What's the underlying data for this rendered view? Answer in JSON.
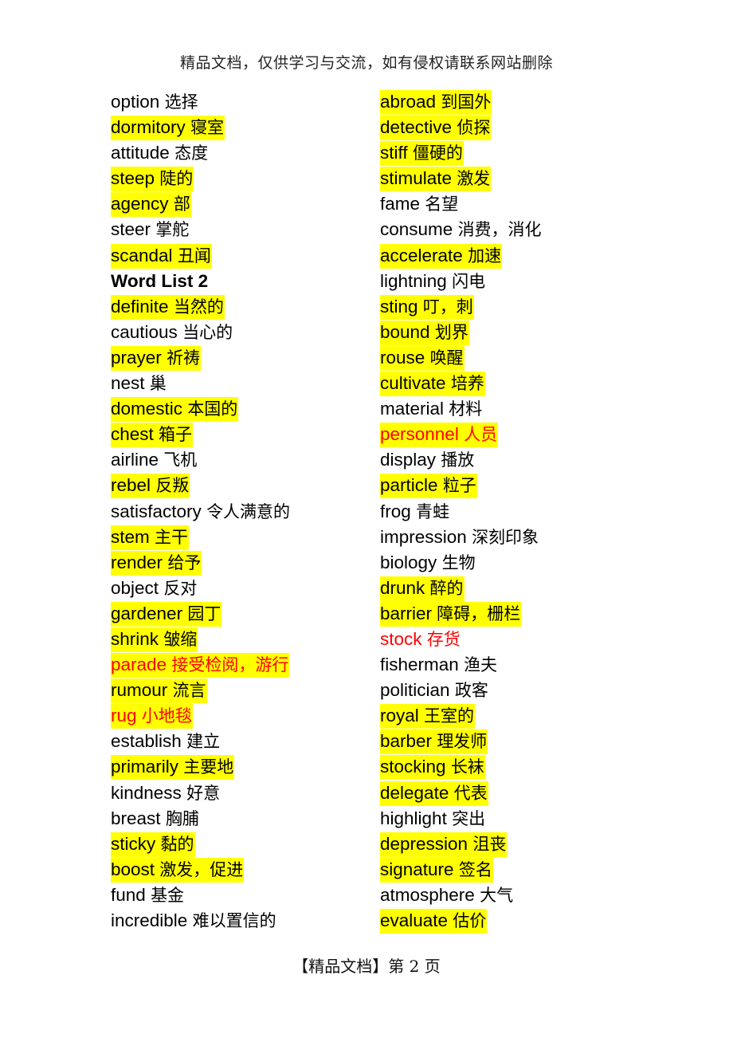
{
  "document": {
    "header": "精品文档，仅供学习与交流，如有侵权请联系网站删除",
    "footer": "【精品文档】第 2 页",
    "colors": {
      "highlight": "#ffff00",
      "emphasis_text": "#ff0000",
      "normal_text": "#000000"
    },
    "left_column": [
      {
        "en": "option",
        "cn": "选择",
        "highlight": false,
        "red": false
      },
      {
        "en": "dormitory",
        "cn": "寝室",
        "highlight": true,
        "red": false
      },
      {
        "en": "attitude",
        "cn": "态度",
        "highlight": false,
        "red": false
      },
      {
        "en": "steep",
        "cn": "陡的",
        "highlight": true,
        "red": false
      },
      {
        "en": "agency",
        "cn": "部",
        "highlight": true,
        "red": false
      },
      {
        "en": "steer",
        "cn": "掌舵",
        "highlight": false,
        "red": false
      },
      {
        "en": "scandal",
        "cn": "丑闻",
        "highlight": true,
        "red": false
      },
      {
        "en": "Word List 2",
        "cn": "",
        "highlight": false,
        "red": false,
        "heading": true
      },
      {
        "en": "definite",
        "cn": "当然的",
        "highlight": true,
        "red": false
      },
      {
        "en": "cautious",
        "cn": "当心的",
        "highlight": false,
        "red": false
      },
      {
        "en": "prayer",
        "cn": "祈祷",
        "highlight": true,
        "red": false
      },
      {
        "en": "nest",
        "cn": "巢",
        "highlight": false,
        "red": false
      },
      {
        "en": "domestic",
        "cn": "本国的",
        "highlight": true,
        "red": false
      },
      {
        "en": "chest",
        "cn": "箱子",
        "highlight": true,
        "red": false
      },
      {
        "en": "airline",
        "cn": "飞机",
        "highlight": false,
        "red": false
      },
      {
        "en": "rebel",
        "cn": "反叛",
        "highlight": true,
        "red": false
      },
      {
        "en": "satisfactory",
        "cn": "令人满意的",
        "highlight": false,
        "red": false
      },
      {
        "en": "stem",
        "cn": "主干",
        "highlight": true,
        "red": false
      },
      {
        "en": "render",
        "cn": "给予",
        "highlight": true,
        "red": false
      },
      {
        "en": "object",
        "cn": "反对",
        "highlight": false,
        "red": false
      },
      {
        "en": "gardener",
        "cn": "园丁",
        "highlight": true,
        "red": false
      },
      {
        "en": "shrink",
        "cn": "皱缩",
        "highlight": true,
        "red": false
      },
      {
        "en": "parade",
        "cn": "接受检阅，游行",
        "highlight": true,
        "red": true
      },
      {
        "en": "rumour",
        "cn": "流言",
        "highlight": true,
        "red": false
      },
      {
        "en": "rug",
        "cn": "小地毯",
        "highlight": true,
        "red": true
      },
      {
        "en": "establish",
        "cn": "建立",
        "highlight": false,
        "red": false
      },
      {
        "en": "primarily",
        "cn": "主要地",
        "highlight": true,
        "red": false
      },
      {
        "en": "kindness",
        "cn": "好意",
        "highlight": false,
        "red": false
      },
      {
        "en": "breast",
        "cn": "胸脯",
        "highlight": false,
        "red": false
      },
      {
        "en": "sticky",
        "cn": "黏的",
        "highlight": true,
        "red": false
      },
      {
        "en": "boost",
        "cn": "激发，促进",
        "highlight": true,
        "red": false
      },
      {
        "en": "fund",
        "cn": "基金",
        "highlight": false,
        "red": false
      },
      {
        "en": "incredible",
        "cn": "难以置信的",
        "highlight": false,
        "red": false
      }
    ],
    "right_column": [
      {
        "en": "abroad",
        "cn": "到国外",
        "highlight": true,
        "red": false
      },
      {
        "en": "detective",
        "cn": "侦探",
        "highlight": true,
        "red": false
      },
      {
        "en": "stiff",
        "cn": "僵硬的",
        "highlight": true,
        "red": false
      },
      {
        "en": "stimulate",
        "cn": "激发",
        "highlight": true,
        "red": false
      },
      {
        "en": "fame",
        "cn": "名望",
        "highlight": false,
        "red": false
      },
      {
        "en": "consume",
        "cn": "消费，消化",
        "highlight": false,
        "red": false
      },
      {
        "en": "accelerate",
        "cn": "加速",
        "highlight": true,
        "red": false
      },
      {
        "en": "lightning",
        "cn": "闪电",
        "highlight": false,
        "red": false
      },
      {
        "en": "sting",
        "cn": "叮，刺",
        "highlight": true,
        "red": false
      },
      {
        "en": "bound",
        "cn": "划界",
        "highlight": true,
        "red": false
      },
      {
        "en": "rouse",
        "cn": "唤醒",
        "highlight": true,
        "red": false
      },
      {
        "en": "cultivate",
        "cn": "培养",
        "highlight": true,
        "red": false
      },
      {
        "en": "material",
        "cn": "材料",
        "highlight": false,
        "red": false
      },
      {
        "en": "personnel",
        "cn": "人员",
        "highlight": true,
        "red": true
      },
      {
        "en": "display",
        "cn": "播放",
        "highlight": false,
        "red": false
      },
      {
        "en": "particle",
        "cn": "粒子",
        "highlight": true,
        "red": false
      },
      {
        "en": "frog",
        "cn": "青蛙",
        "highlight": false,
        "red": false
      },
      {
        "en": "impression",
        "cn": "深刻印象",
        "highlight": false,
        "red": false
      },
      {
        "en": "biology",
        "cn": "生物",
        "highlight": false,
        "red": false
      },
      {
        "en": "drunk",
        "cn": "醉的",
        "highlight": true,
        "red": false
      },
      {
        "en": "barrier",
        "cn": "障碍，栅栏",
        "highlight": true,
        "red": false
      },
      {
        "en": "stock",
        "cn": "存货",
        "highlight": false,
        "red": true
      },
      {
        "en": "fisherman",
        "cn": "渔夫",
        "highlight": false,
        "red": false
      },
      {
        "en": "politician",
        "cn": "政客",
        "highlight": false,
        "red": false
      },
      {
        "en": "royal",
        "cn": "王室的",
        "highlight": true,
        "red": false
      },
      {
        "en": "barber",
        "cn": "理发师",
        "highlight": true,
        "red": false
      },
      {
        "en": "stocking",
        "cn": "长袜",
        "highlight": true,
        "red": false
      },
      {
        "en": "delegate",
        "cn": "代表",
        "highlight": true,
        "red": false
      },
      {
        "en": "highlight",
        "cn": "突出",
        "highlight": false,
        "red": false
      },
      {
        "en": "depression",
        "cn": "沮丧",
        "highlight": true,
        "red": false
      },
      {
        "en": "signature",
        "cn": "签名",
        "highlight": true,
        "red": false
      },
      {
        "en": "atmosphere",
        "cn": "大气",
        "highlight": false,
        "red": false
      },
      {
        "en": "evaluate",
        "cn": "估价",
        "highlight": true,
        "red": false
      }
    ]
  }
}
